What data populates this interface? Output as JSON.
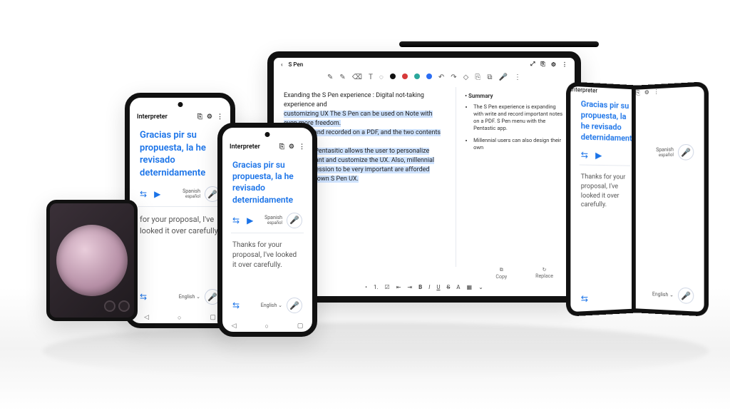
{
  "interpreter": {
    "title": "Interpreter",
    "translated": "Gracias pir su propuesta, la he revisado deternidamente",
    "source": "Thanks for your proposal, I've looked it over carefully.",
    "source_short": "Thanks for your proposal, I've looked it over carefully.",
    "src_partial": "for your proposal, I've looked it over carefully.",
    "lang_out": "Spanish",
    "lang_out_sub": "español",
    "lang_in": "English"
  },
  "tablet": {
    "title": "S Pen",
    "note_line1": "Exanding the S Pen experience : Digital not-taking experience and",
    "note_hl1": "customizing UX The S Pen can be used on Note with even more freedom.",
    "note_hl2": "be written and recorded on a PDF, and the two contents",
    "note_hl3": "app called Pentasitic allows the user to personalize",
    "note_hl4": "that they want and customize the UX. Also, millennial",
    "note_hl5": "rsonal expression to be very important are afforded",
    "note_hl6": "igning their own S Pen UX.",
    "summary_title": "Summary",
    "bullet1": "The S Pen experience is expanding with write and record important notes on a PDF. S Pen menu with the Pentastic app.",
    "bullet2": "Millennial users can also design their own",
    "copy": "Copy",
    "replace": "Replace",
    "colors": {
      "black": "#111",
      "red": "#d73a3a",
      "teal": "#2aa79b",
      "blue": "#2a6df4"
    }
  },
  "icons": {
    "back": "‹",
    "settings": "⚙",
    "bookmark": "⎘",
    "more": "⋮",
    "enlarge": "⤢",
    "swap": "⇆",
    "play": "▶",
    "mic": "🎤",
    "copy": "⧉",
    "pencil": "✎",
    "eraser": "⌫",
    "undo": "↶",
    "redo": "↷",
    "text": "T",
    "shape": "◇",
    "lasso": "◌",
    "list_ul": "•",
    "list_ol": "1.",
    "list_check": "☑",
    "indent_dec": "⇤",
    "indent_inc": "⇥",
    "bold": "B",
    "italic": "I",
    "underline": "U",
    "strike": "S",
    "color": "A",
    "highlight": "▦",
    "nav_back": "◁",
    "nav_home": "○",
    "nav_recent": "▢",
    "chevron": "⌄",
    "replace": "↻"
  }
}
